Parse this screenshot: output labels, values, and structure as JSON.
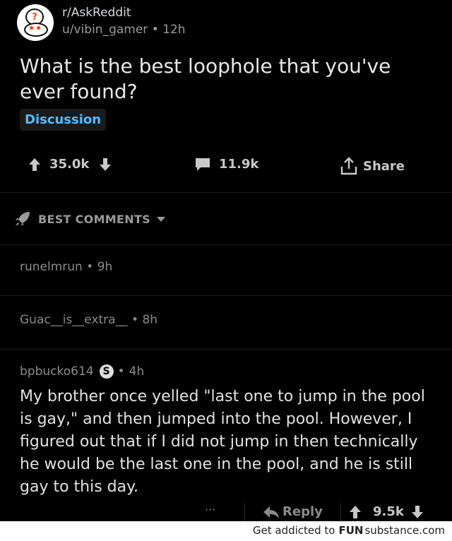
{
  "post": {
    "subreddit": "r/AskReddit",
    "author": "u/vibin_gamer",
    "age": "12h",
    "title": "What is the best loophole that you've ever found?",
    "flair": "Discussion",
    "upvotes": "35.0k",
    "comments": "11.9k",
    "share_label": "Share"
  },
  "sort": {
    "label": "BEST COMMENTS"
  },
  "collapsed_comments": [
    {
      "author": "runelmrun",
      "age": "9h"
    },
    {
      "author": "Guac__is__extra__",
      "age": "8h"
    }
  ],
  "comment": {
    "author": "bpbucko614",
    "badge": "S",
    "age": "4h",
    "body": "My brother once yelled \"last one to jump in the pool is gay,\" and then jumped into the pool. However, I figured out that if I did not jump in then technically he would be the last one in the pool, and he is still gay to this day.",
    "more": "···",
    "reply_label": "Reply",
    "score": "9.5k"
  },
  "footer": {
    "text": "Get addicted to",
    "brand_bold": "FUN",
    "brand_rest": "substance.com"
  },
  "colors": {
    "background": "#000000",
    "flair": "#4fbcff",
    "text": "#d7dadc",
    "muted": "#8a8a8a"
  },
  "icons": [
    "reddit-alien-icon",
    "upvote-arrow-icon",
    "downvote-arrow-icon",
    "comment-bubble-icon",
    "share-icon",
    "rocket-icon",
    "caret-down-icon",
    "reply-arrow-icon"
  ]
}
